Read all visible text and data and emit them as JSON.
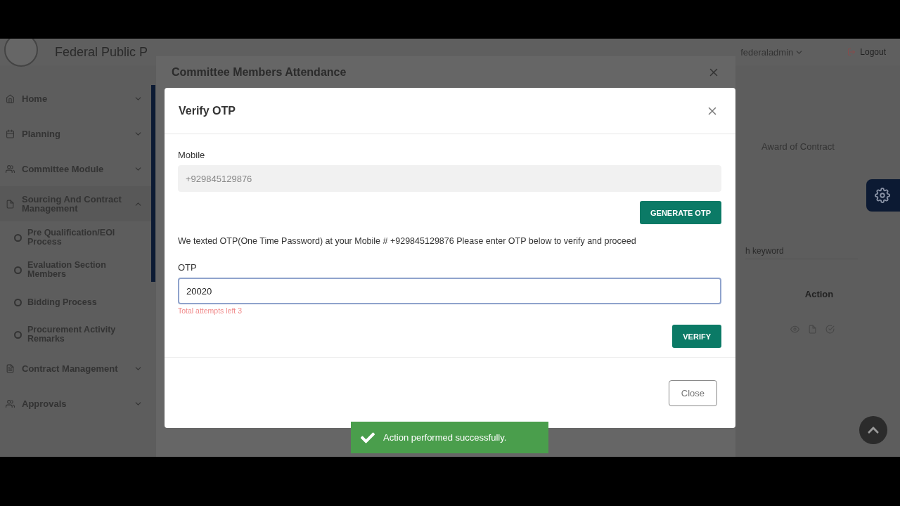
{
  "header": {
    "title": "Federal Public P",
    "user": "federaladmin",
    "logout": "Logout"
  },
  "sidebar": {
    "items": [
      {
        "label": "Home",
        "expanded": false
      },
      {
        "label": "Planning",
        "expanded": false
      },
      {
        "label": "Committee Module",
        "expanded": false
      },
      {
        "label": "Sourcing And Contract Management",
        "expanded": true,
        "children": [
          {
            "label": "Pre Qualification/EOI Process"
          },
          {
            "label": "Evaluation Section Members"
          },
          {
            "label": "Bidding Process"
          },
          {
            "label": "Procurement Activity Remarks"
          }
        ]
      },
      {
        "label": "Contract Management",
        "expanded": false
      },
      {
        "label": "Approvals",
        "expanded": false
      }
    ]
  },
  "background_modal": {
    "title": "Committee Members Attendance"
  },
  "background_page": {
    "card_title": "Award of Contract",
    "search_placeholder": "h keyword",
    "table_header": "Action"
  },
  "dialog": {
    "title": "Verify OTP",
    "mobile_label": "Mobile",
    "mobile_value": "+929845129876",
    "mobile_disabled": true,
    "generate_button": "GENERATE OTP",
    "message": "We texted OTP(One Time Password) at your Mobile # +929845129876 Please enter OTP below to verify and proceed",
    "otp_label": "OTP",
    "otp_value": "20020",
    "attempts": "Total attempts left 3",
    "verify_button": "VERIFY",
    "close_button": "Close"
  },
  "toast": {
    "message": "Action performed successfully."
  }
}
